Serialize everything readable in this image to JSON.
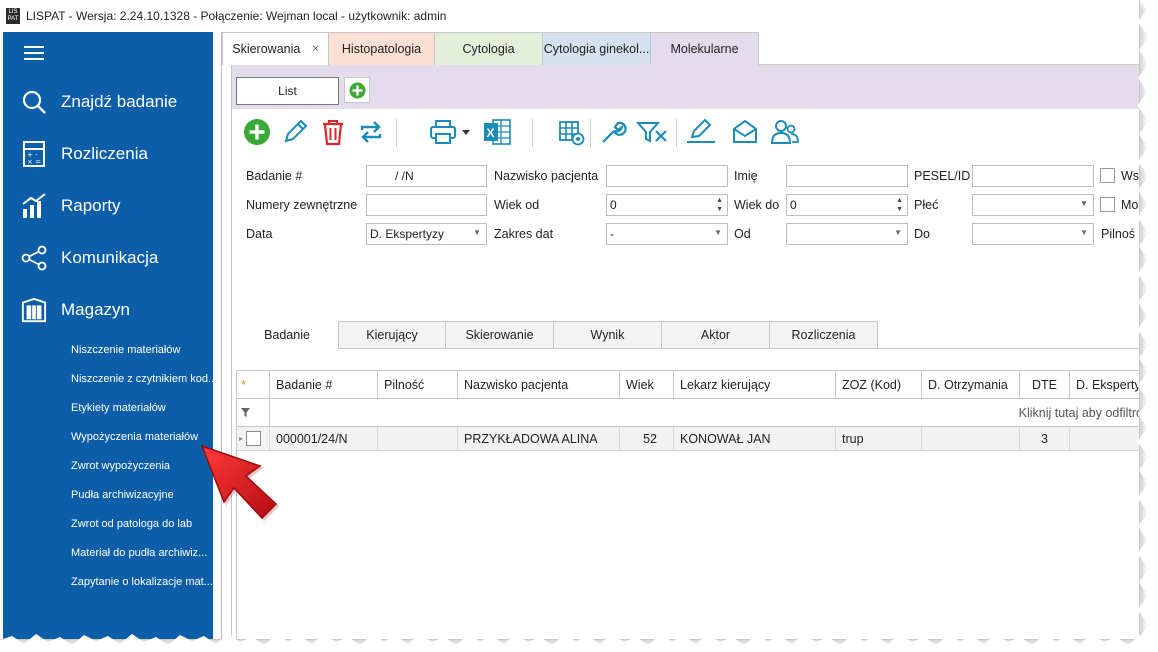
{
  "window": {
    "logo": "LIS PAT",
    "title": "LISPAT - Wersja: 2.24.10.1328 - Połączenie: Wejman local - użytkownik: admin"
  },
  "colors": {
    "sidebar": "#0d5ea8",
    "tab_histopatologia": "#fbe0d3",
    "tab_cytologia": "#e3efd9",
    "tab_cytologia_ginek": "#d5e1ee",
    "tab_molekularne": "#e4dcec",
    "toolbar_icon": "#1a8cb8",
    "delete_icon": "#d8262c",
    "add_icon": "#3aa935",
    "arrow": "#e5161c"
  },
  "sidebar": {
    "nav": [
      {
        "label": "Znajdź badanie",
        "icon": "search-icon"
      },
      {
        "label": "Rozliczenia",
        "icon": "calculator-icon"
      },
      {
        "label": "Raporty",
        "icon": "chart-icon"
      },
      {
        "label": "Komunikacja",
        "icon": "share-icon"
      },
      {
        "label": "Magazyn",
        "icon": "warehouse-icon"
      }
    ],
    "sub_items": [
      "Niszczenie materiałów",
      "Niszczenie z czytnikiem kod...",
      "Etykiety materiałów",
      "Wypożyczenia materiałów",
      "Zwrot wypożyczenia",
      "Pudła archiwizacyjne",
      "Zwrot od patologa do lab",
      "Materiał do pudła archiwiz...",
      "Zapytanie o lokalizacje mat..."
    ]
  },
  "doc_tabs": [
    {
      "label": "Skierowania",
      "close": "×"
    },
    {
      "label": "Histopatologia"
    },
    {
      "label": "Cytologia"
    },
    {
      "label": "Cytologia ginekol..."
    },
    {
      "label": "Molekularne"
    }
  ],
  "list_tab": "List",
  "filters": {
    "badanie_label": "Badanie #",
    "badanie_value": "/  /N",
    "nazwisko_label": "Nazwisko pacjenta",
    "nazwisko_value": "",
    "imie_label": "Imię",
    "imie_value": "",
    "pesel_label": "PESEL/ID",
    "pesel_value": "",
    "check1_label": "Ws",
    "numery_label": "Numery zewnętrzne",
    "numery_value": "",
    "wiek_od_label": "Wiek od",
    "wiek_od_value": "0",
    "wiek_do_label": "Wiek do",
    "wiek_do_value": "0",
    "plec_label": "Płeć",
    "plec_value": "",
    "check2_label": "Mo",
    "data_label": "Data",
    "data_value": "D. Ekspertyzy",
    "zakres_label": "Zakres dat",
    "zakres_value": "-",
    "od_label": "Od",
    "od_value": "",
    "do_label": "Do",
    "do_value": "",
    "pilnosc_label": "Pilnoś"
  },
  "detail_tabs": [
    "Badanie",
    "Kierujący",
    "Skierowanie",
    "Wynik",
    "Aktor",
    "Rozliczenia"
  ],
  "grid": {
    "headers": [
      "Badanie #",
      "Pilność",
      "Nazwisko pacjenta",
      "Wiek",
      "Lekarz kierujący",
      "ZOZ (Kod)",
      "D. Otrzymania",
      "DTE",
      "D. Ekspertyz"
    ],
    "new_row_marker": "*",
    "filter_hint": "Kliknij tutaj aby odfiltro",
    "rows": [
      {
        "badanie": "000001/24/N",
        "pilnosc": "",
        "nazwisko": "PRZYKŁADOWA ALINA",
        "wiek": "52",
        "lekarz": "KONOWAŁ JAN",
        "zoz": "trup",
        "d_otrzymania": "",
        "dte": "3",
        "d_ekspertyzy": ""
      }
    ]
  }
}
